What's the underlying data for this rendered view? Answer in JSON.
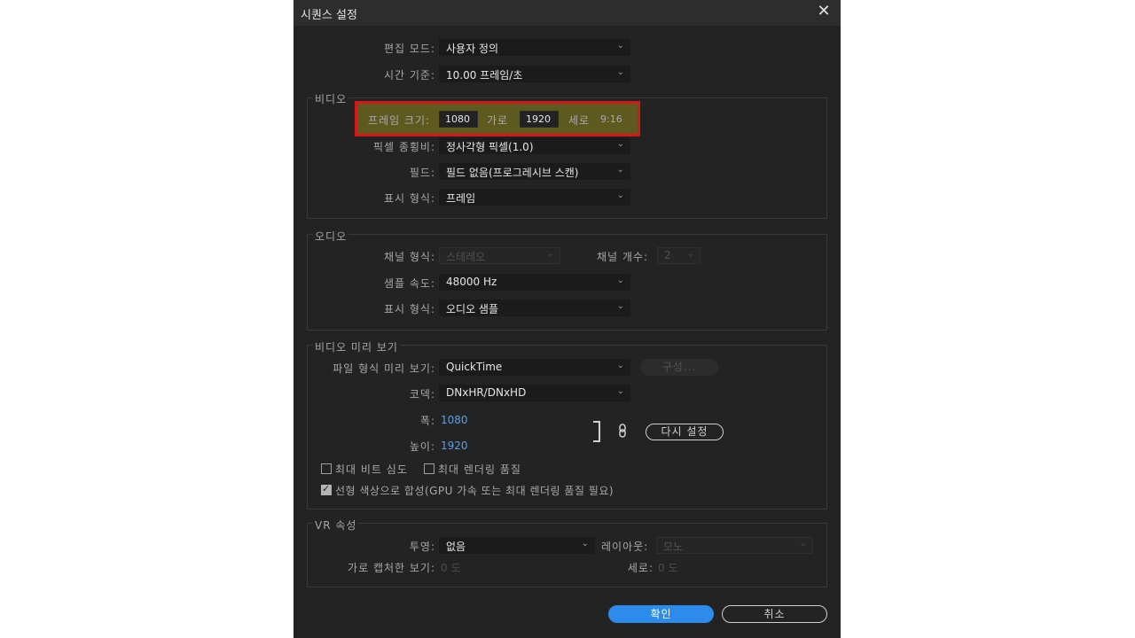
{
  "window": {
    "title": "시퀀스 설정",
    "close_glyph": "✕"
  },
  "general": {
    "edit_mode_label": "편집 모드:",
    "edit_mode_value": "사용자 정의",
    "timebase_label": "시간 기준:",
    "timebase_value": "10.00  프레임/초"
  },
  "video": {
    "title": "비디오",
    "frame_size_label": "프레임 크기:",
    "width_value": "1080",
    "width_label": "가로",
    "height_value": "1920",
    "height_label": "세로",
    "aspect": "9:16",
    "pixel_aspect_label": "픽셀 종횡비:",
    "pixel_aspect_value": "정사각형 픽셀(1.0)",
    "fields_label": "필드:",
    "fields_value": "필드 없음(프로그레시브 스캔)",
    "display_label": "표시 형식:",
    "display_value": "프레임"
  },
  "audio": {
    "title": "오디오",
    "channel_format_label": "채널 형식:",
    "channel_format_value": "스테레오",
    "channel_count_label": "채널 개수:",
    "channel_count_value": "2",
    "sample_rate_label": "샘플 속도:",
    "sample_rate_value": "48000 Hz",
    "display_label": "표시 형식:",
    "display_value": "오디오 샘플"
  },
  "preview": {
    "title": "비디오 미리 보기",
    "file_format_label": "파일 형식 미리 보기:",
    "file_format_value": "QuickTime",
    "configure_label": "구성...",
    "codec_label": "코덱:",
    "codec_value": "DNxHR/DNxHD",
    "width_label": "폭:",
    "width_value": "1080",
    "height_label": "높이:",
    "height_value": "1920",
    "reset_label": "다시 설정",
    "max_bit_depth_label": "최대 비트 심도",
    "max_render_quality_label": "최대 렌더링 품질",
    "linear_color_label": "선형 색상으로 합성(GPU 가속 또는 최대 렌더링 품질 필요)"
  },
  "vr": {
    "title": "VR 속성",
    "projection_label": "투영:",
    "projection_value": "없음",
    "layout_label": "레이아웃:",
    "layout_value": "모노",
    "h_fov_label": "가로 캡처한 보기:",
    "h_fov_value": "0 도",
    "v_fov_label": "세로:",
    "v_fov_value": "0 도"
  },
  "footer": {
    "ok_label": "확인",
    "cancel_label": "취소"
  },
  "colors": {
    "accent": "#2d8ceb",
    "highlight_border": "#d3171b",
    "highlight_fill": "#5e5a1f"
  }
}
